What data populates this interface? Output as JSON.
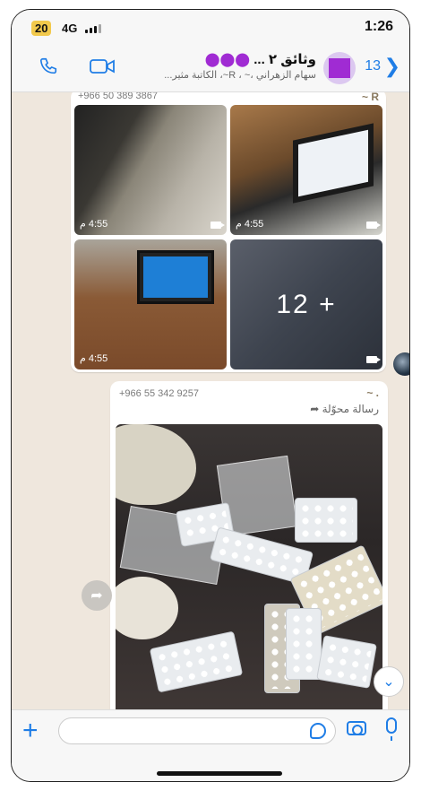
{
  "status": {
    "battery": "20",
    "network": "4G",
    "time": "1:26"
  },
  "header": {
    "back_count": "13",
    "title": "وثائق ٢ ... ",
    "subtitle": "سهام الزهراني ،~ ، R~، الكاتبة مثير..."
  },
  "messages": {
    "album": {
      "phone": "+966 50 389 3867",
      "sender": "~ R",
      "timestamps": [
        "4:55 م",
        "4:55 م",
        "4:55 م"
      ],
      "more_count": "12 +"
    },
    "forwarded": {
      "phone": "+966 55 342 9257",
      "sender": "~ .",
      "forwarded_label": "رسالة محوّلة"
    }
  },
  "input": {
    "placeholder": ""
  },
  "colors": {
    "accent": "#1f7de6",
    "chat_bg": "#efe7dd",
    "avatar": "#a02bd3"
  }
}
